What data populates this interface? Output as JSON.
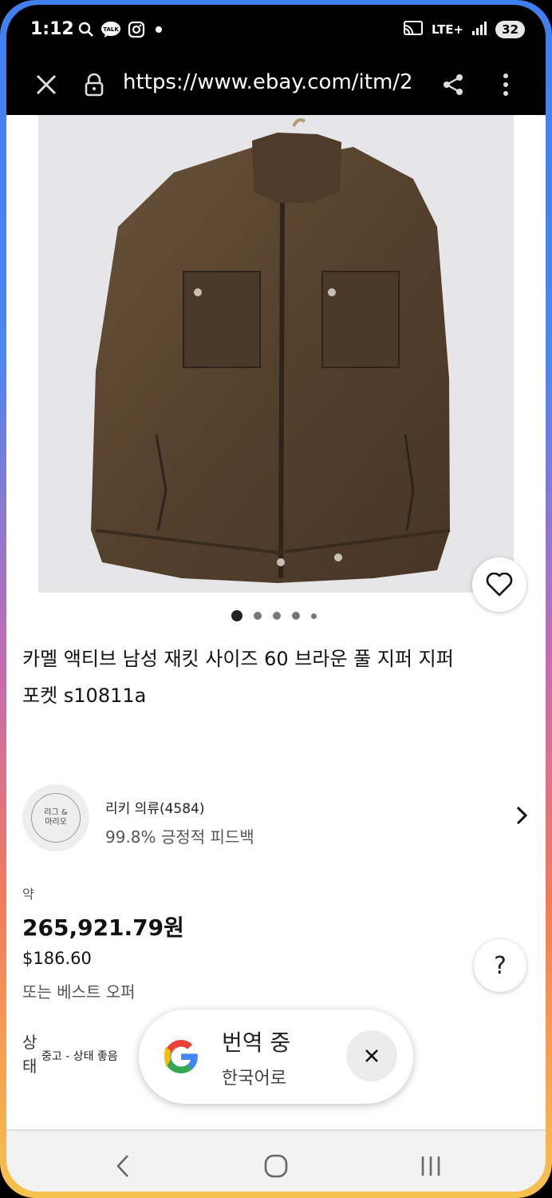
{
  "status_bar": {
    "time": "1:12",
    "icons_left": [
      "search-icon",
      "talk-icon",
      "instagram-icon",
      "dot-icon"
    ],
    "network": "LTE+",
    "battery": "32"
  },
  "browser": {
    "url": "https://www.ebay.com/itm/2",
    "close_icon": "close-icon",
    "lock_icon": "lock-icon",
    "share_icon": "share-icon",
    "menu_icon": "more-vert-icon"
  },
  "listing": {
    "image_alt": "brown jacket on hanger",
    "image_count": 5,
    "active_image": 1,
    "title": "카멜 액티브 남성 재킷 사이즈 60 브라운 풀 지퍼 지퍼 포켓 s10811a"
  },
  "seller": {
    "avatar_text_line1": "리그 &",
    "avatar_text_line2": "마리오",
    "name": "리키 의류(4584)",
    "feedback": "99.8% 긍정적 피드백"
  },
  "price": {
    "prefix": "약",
    "krw": "265,921.79원",
    "usd": "$186.60",
    "offer": "또는 베스트 오퍼"
  },
  "condition": {
    "label": "상태",
    "value": "중고 - 상태 좋음"
  },
  "translate_popup": {
    "title": "번역 중",
    "subtitle": "한국어로"
  },
  "colors": {
    "jacket": "#5a4430",
    "photo_bg": "#e6e6e8",
    "google_blue": "#4285F4",
    "google_red": "#EA4335",
    "google_yellow": "#FBBC05",
    "google_green": "#34A853"
  }
}
